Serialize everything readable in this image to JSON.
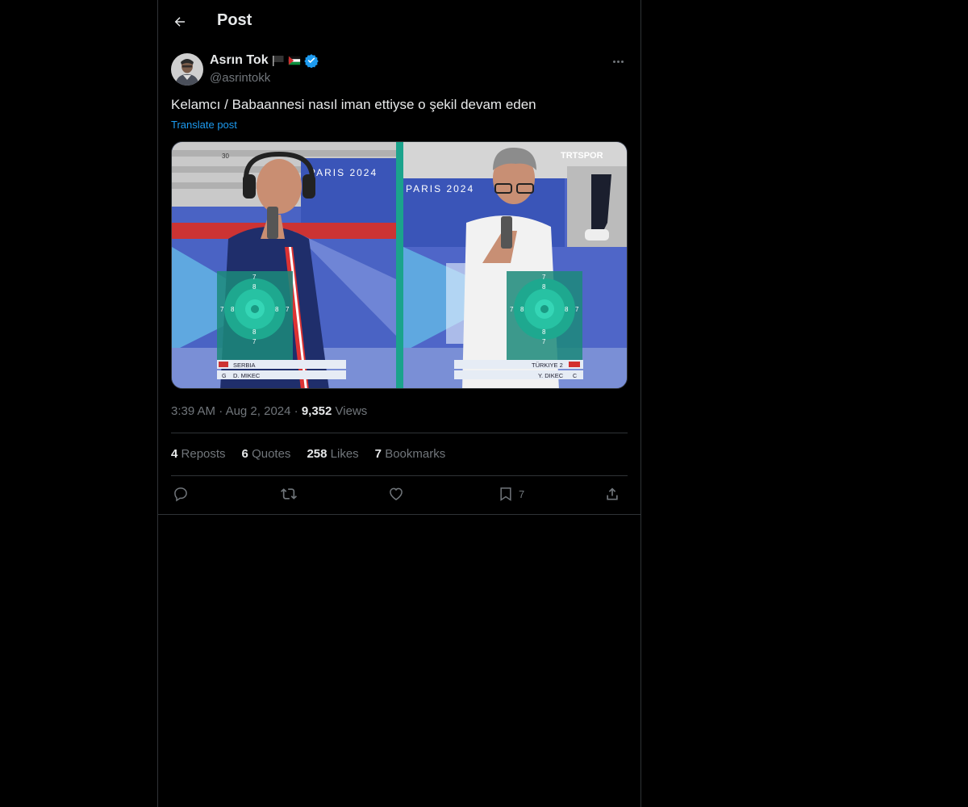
{
  "header": {
    "title": "Post",
    "back_icon": "arrow-left-icon"
  },
  "post": {
    "author": {
      "display_name": "Asrın Tok",
      "handle": "@asrintokk",
      "verified": true,
      "flags": [
        "black-flag-icon",
        "palestine-flag-icon"
      ]
    },
    "text": "Kelamcı / Babaannesi nasıl iman ettiyse o şekil devam eden",
    "translate_label": "Translate post",
    "media": {
      "left_panel": {
        "banner": "PARIS 2024",
        "country": "SERBIA",
        "athlete": "D. MIKEC",
        "athlete_tag": "G",
        "counter": "30",
        "target_rings": [
          "7",
          "8",
          "7",
          "8",
          "8",
          "7",
          "8",
          "7"
        ]
      },
      "right_panel": {
        "banner": "PARIS 2024",
        "broadcaster": "TRTSPOR",
        "country": "TÜRKIYE 2",
        "athlete": "Y. DIKEC",
        "athlete_tag": "C",
        "target_rings": [
          "7",
          "8",
          "7",
          "8",
          "8",
          "7",
          "8",
          "7"
        ]
      }
    },
    "time": "3:39 AM",
    "date": "Aug 2, 2024",
    "sep": "·",
    "views_count": "9,352",
    "views_label": "Views",
    "stats": {
      "reposts_count": "4",
      "reposts_label": "Reposts",
      "quotes_count": "6",
      "quotes_label": "Quotes",
      "likes_count": "258",
      "likes_label": "Likes",
      "bookmarks_count": "7",
      "bookmarks_label": "Bookmarks"
    },
    "actions": {
      "bookmark_count": "7"
    }
  },
  "colors": {
    "background": "#000000",
    "text": "#e7e9ea",
    "secondary": "#71767b",
    "accent": "#1d9bf0",
    "border": "#2f3336"
  }
}
